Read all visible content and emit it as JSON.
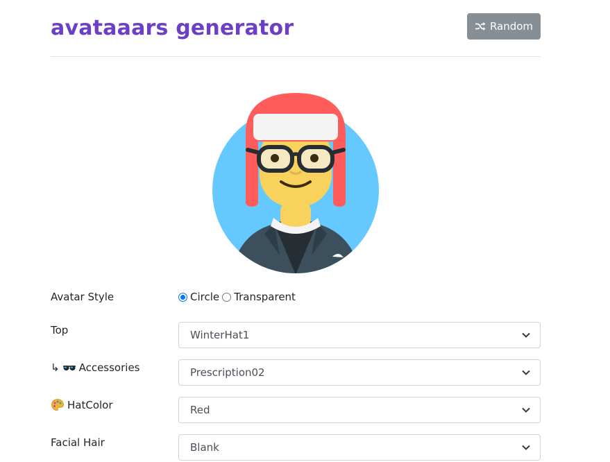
{
  "header": {
    "title": "avataaars generator",
    "random_label": "Random"
  },
  "avatar": {
    "colors": {
      "background": "#65c9ff",
      "hat": "#ff5c5c",
      "hat_band": "#f4f4f4",
      "skin": "#f8d25c",
      "jacket": "#3c4f5c",
      "shirt": "#262e33",
      "accent": "#6c3fc4"
    }
  },
  "form": {
    "avatar_style": {
      "label": "Avatar Style",
      "options": [
        "Circle",
        "Transparent"
      ],
      "selected": "Circle"
    },
    "fields": [
      {
        "label": "Top",
        "value": "WinterHat1",
        "icon": ""
      },
      {
        "label": "↳ 🕶 Accessories",
        "label_text": "Accessories",
        "value": "Prescription02",
        "icon": "sunglasses-icon"
      },
      {
        "label": "HatColor",
        "label_text": "HatColor",
        "value": "Red",
        "icon": "palette-icon"
      },
      {
        "label": "Facial Hair",
        "value": "Blank",
        "icon": ""
      }
    ]
  }
}
